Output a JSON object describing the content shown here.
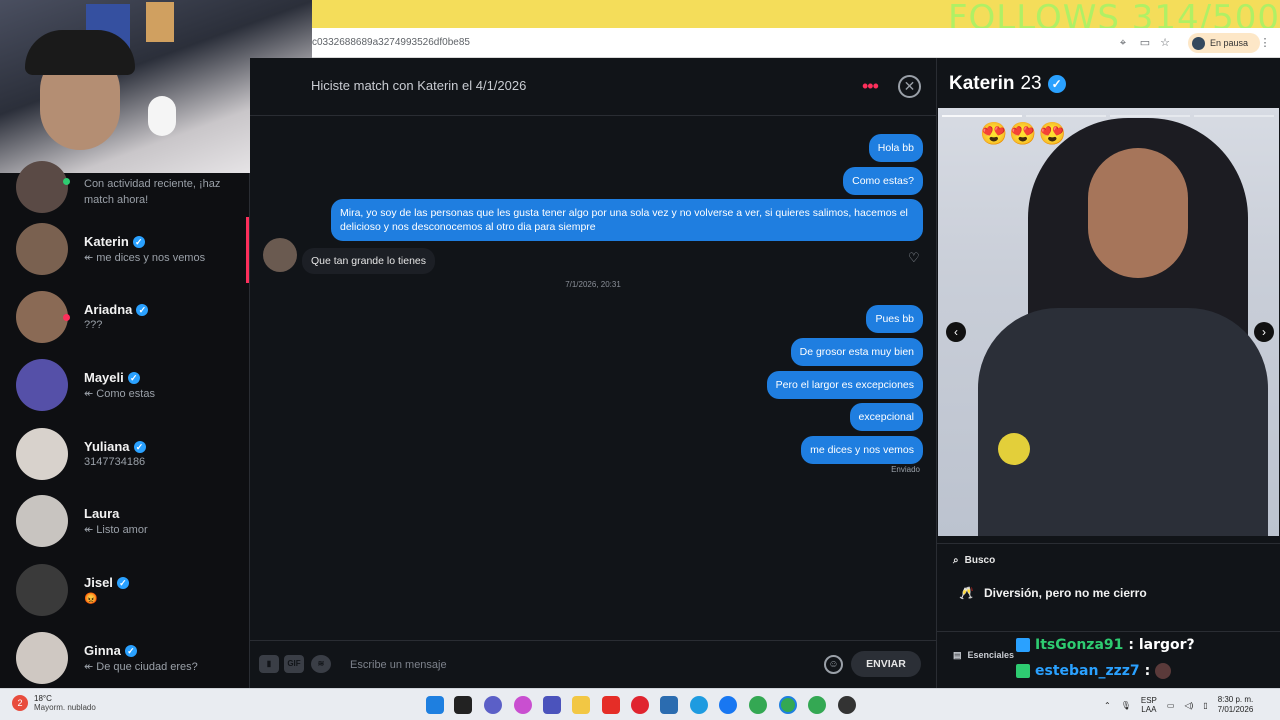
{
  "stream_overlay": {
    "follows": "FOLLOWS 314/500"
  },
  "browser": {
    "url": "c0332688689a3274993526df0be85",
    "profile_status": "En pausa"
  },
  "sidebar": {
    "top_item": {
      "sub": "Con actividad reciente, ¡haz match ahora!"
    },
    "matches": [
      {
        "name": "Katerin",
        "sub": "↞ me dices y nos vemos",
        "verified": true
      },
      {
        "name": "Ariadna",
        "sub": "???",
        "verified": true
      },
      {
        "name": "Mayeli",
        "sub": "↞ Como estas",
        "verified": true
      },
      {
        "name": "Yuliana",
        "sub": "3147734186",
        "verified": true
      },
      {
        "name": "Laura",
        "sub": "↞ Listo amor",
        "verified": false
      },
      {
        "name": "Jisel",
        "sub": "😡",
        "verified": true
      },
      {
        "name": "Ginna",
        "sub": "↞ De que ciudad eres?",
        "verified": true
      }
    ]
  },
  "chat": {
    "header": "Hiciste match con Katerin el 4/1/2026",
    "messages_out_1": [
      "Hola bb",
      "Como estas?"
    ],
    "long_message": "Mira, yo soy de las personas que les gusta tener algo por una sola vez y no volverse a ver, si quieres salimos, hacemos el delicioso y nos desconocemos al otro dia para siempre",
    "message_in": "Que tan grande lo tienes",
    "date_divider": "7/1/2026, 20:31",
    "messages_out_2": [
      "Pues bb",
      "De grosor esta muy bien",
      "Pero el largor es excepciones",
      "excepcional",
      "me dices y nos vemos"
    ],
    "sent_status": "Enviado",
    "composer": {
      "placeholder": "Escribe un mensaje",
      "gif_label": "GIF",
      "send_label": "ENVIAR"
    }
  },
  "profile": {
    "name": "Katerin",
    "age": "23",
    "photo_emoji": "😍😍😍",
    "busco_label": "Busco",
    "busco_value": "Diversión, pero no me cierro",
    "busco_emoji": "🥂",
    "essentials_label": "Esenciales"
  },
  "stream_chat": [
    {
      "user": "ItsGonza91",
      "text": ": largor?",
      "color": "#2ecc71"
    },
    {
      "user": "esteban_zzz7",
      "text": ":",
      "color": "#2aa1ff"
    }
  ],
  "taskbar": {
    "weather_temp": "18°C",
    "weather_desc": "Mayorm. nublado",
    "lang_1": "ESP",
    "lang_2": "LAA",
    "time": "8:30 p. m.",
    "date": "7/01/2026"
  },
  "colors": {
    "accent": "#fd2f5b",
    "bubble": "#1f7ee0",
    "verified": "#2aa1ff"
  }
}
